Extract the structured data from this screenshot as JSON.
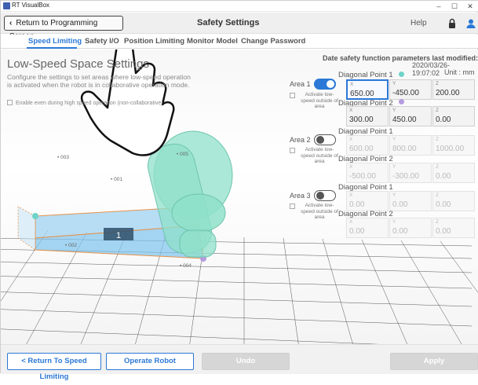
{
  "window": {
    "title": "RT VisualBox",
    "minimize": "–",
    "maximize": "☐",
    "close": "✕"
  },
  "header": {
    "back_label": "Return to Programming Screen",
    "title": "Safety Settings",
    "help": "Help"
  },
  "tabs": [
    {
      "label": "Speed Limiting",
      "active": true
    },
    {
      "label": "Safety I/O",
      "active": false
    },
    {
      "label": "Position Limiting",
      "active": false
    },
    {
      "label": "Monitor Model",
      "active": false
    },
    {
      "label": "Change Password",
      "active": false
    }
  ],
  "left_panel": {
    "title": "Low-Speed Space Settings",
    "description": "Configure the settings to set areas where low-speed operation is activated when the robot is in collaborative operation mode.",
    "checkbox_label": "Enable even during high speed operation (non-collaborative)"
  },
  "right_panel": {
    "date_label": "Date safety function parameters last modified:",
    "date_value": "2020/03/26-19:07:02",
    "unit": "Unit : mm"
  },
  "areas": [
    {
      "label": "Area 1",
      "enabled": true,
      "activate_label": "Activate low-speed outside of area",
      "dp1_label": "Diagonal Point 1",
      "dp1_color": "#6fd3c8",
      "dp1": {
        "x": "650.00",
        "y": "-450.00",
        "z": "200.00"
      },
      "dp2_label": "Diagonal Point 2",
      "dp2_color": "#b59be0",
      "dp2": {
        "x": "300.00",
        "y": "450.00",
        "z": "0.00"
      }
    },
    {
      "label": "Area 2",
      "enabled": false,
      "activate_label": "Activate low-speed outside of area",
      "dp1_label": "Diagonal Point 1",
      "dp1": {
        "x": "600.00",
        "y": "800.00",
        "z": "1000.00"
      },
      "dp2_label": "Diagonal Point 2",
      "dp2": {
        "x": "-500.00",
        "y": "-300.00",
        "z": "0.00"
      }
    },
    {
      "label": "Area 3",
      "enabled": false,
      "activate_label": "Activate low-speed outside of area",
      "dp1_label": "Diagonal Point 1",
      "dp1": {
        "x": "0.00",
        "y": "0.00",
        "z": "0.00"
      },
      "dp2_label": "Diagonal Point 2",
      "dp2": {
        "x": "0.00",
        "y": "0.00",
        "z": "0.00"
      }
    }
  ],
  "axis_labels": {
    "x": "X",
    "y": "Y",
    "z": "Z"
  },
  "scene_labels": {
    "p003": "003",
    "p005": "005",
    "p001": "001",
    "p002": "002",
    "p004": "004",
    "area_number": "1"
  },
  "bottom": {
    "return_label": "< Return To Speed Limiting",
    "operate_label": "Operate Robot",
    "undo_label": "Undo",
    "apply_label": "Apply"
  },
  "colors": {
    "accent": "#2b78d6",
    "area_box": "#7ec3ec",
    "robot": "#8fe0c9"
  }
}
